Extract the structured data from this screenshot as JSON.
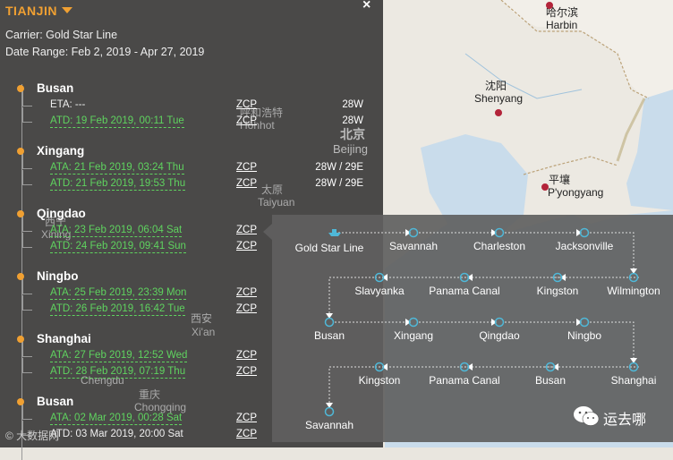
{
  "panel": {
    "title": "TIANJIN",
    "carrier": "Carrier: Gold Star Line",
    "date_range": "Date Range: Feb 2, 2019 - Apr 27, 2019"
  },
  "ports": [
    {
      "name": "Busan",
      "events": [
        {
          "text": "ETA: ---",
          "actual": false,
          "service": "ZCP",
          "voyage": "28W"
        },
        {
          "text": "ATD: 19 Feb 2019, 00:11 Tue",
          "actual": true,
          "service": "ZCP",
          "voyage": "28W"
        }
      ]
    },
    {
      "name": "Xingang",
      "events": [
        {
          "text": "ATA: 21 Feb 2019, 03:24 Thu",
          "actual": true,
          "service": "ZCP",
          "voyage": "28W / 29E"
        },
        {
          "text": "ATD: 21 Feb 2019, 19:53 Thu",
          "actual": true,
          "service": "ZCP",
          "voyage": "28W / 29E"
        }
      ]
    },
    {
      "name": "Qingdao",
      "events": [
        {
          "text": "ATA: 23 Feb 2019, 06:04 Sat",
          "actual": true,
          "service": "ZCP",
          "voyage": ""
        },
        {
          "text": "ATD: 24 Feb 2019, 09:41 Sun",
          "actual": true,
          "service": "ZCP",
          "voyage": ""
        }
      ]
    },
    {
      "name": "Ningbo",
      "events": [
        {
          "text": "ATA: 25 Feb 2019, 23:39 Mon",
          "actual": true,
          "service": "ZCP",
          "voyage": ""
        },
        {
          "text": "ATD: 26 Feb 2019, 16:42 Tue",
          "actual": true,
          "service": "ZCP",
          "voyage": ""
        }
      ]
    },
    {
      "name": "Shanghai",
      "events": [
        {
          "text": "ATA: 27 Feb 2019, 12:52 Wed",
          "actual": true,
          "service": "ZCP",
          "voyage": ""
        },
        {
          "text": "ATD: 28 Feb 2019, 07:19 Thu",
          "actual": true,
          "service": "ZCP",
          "voyage": ""
        }
      ]
    },
    {
      "name": "Busan",
      "events": [
        {
          "text": "ATA: 02 Mar 2019, 00:28 Sat",
          "actual": true,
          "service": "ZCP",
          "voyage": ""
        },
        {
          "text": "ATD: 03 Mar 2019, 20:00 Sat",
          "actual": false,
          "service": "ZCP",
          "voyage": ""
        }
      ]
    }
  ],
  "route": {
    "start_label": "Gold Star Line",
    "stops": [
      "Savannah",
      "Charleston",
      "Jacksonville",
      "Wilmington",
      "Kingston",
      "Panama Canal",
      "Slavyanka",
      "Busan",
      "Xingang",
      "Qingdao",
      "Ningbo",
      "Shanghai",
      "Busan",
      "Panama Canal",
      "Kingston",
      "Savannah"
    ]
  },
  "map_labels": [
    {
      "text": "哈尔滨",
      "cn": true
    },
    {
      "text": "Harbin"
    },
    {
      "text": "沈阳",
      "cn": true
    },
    {
      "text": "Shenyang"
    },
    {
      "text": "北京",
      "cn": true
    },
    {
      "text": "Beijing"
    },
    {
      "text": "平壤",
      "cn": true
    },
    {
      "text": "P'yongyang"
    },
    {
      "text": "太原",
      "cn": true
    },
    {
      "text": "Taiyuan"
    },
    {
      "text": "西安",
      "cn": true
    },
    {
      "text": "Xi'an"
    },
    {
      "text": "重庆",
      "cn": true
    },
    {
      "text": "Chongqing"
    },
    {
      "text": "Chengdu"
    },
    {
      "text": "呼和浩特",
      "cn": true
    },
    {
      "text": "Hohhot"
    },
    {
      "text": "西宁",
      "cn": true
    },
    {
      "text": "Xining"
    }
  ],
  "watermark": {
    "brand": "运去哪",
    "corner": "© 大数据网"
  },
  "colors": {
    "accent": "#f0a032",
    "actual_green": "#5fd35f",
    "route_node": "#4fb8d8",
    "capital_red": "#b3243a"
  }
}
